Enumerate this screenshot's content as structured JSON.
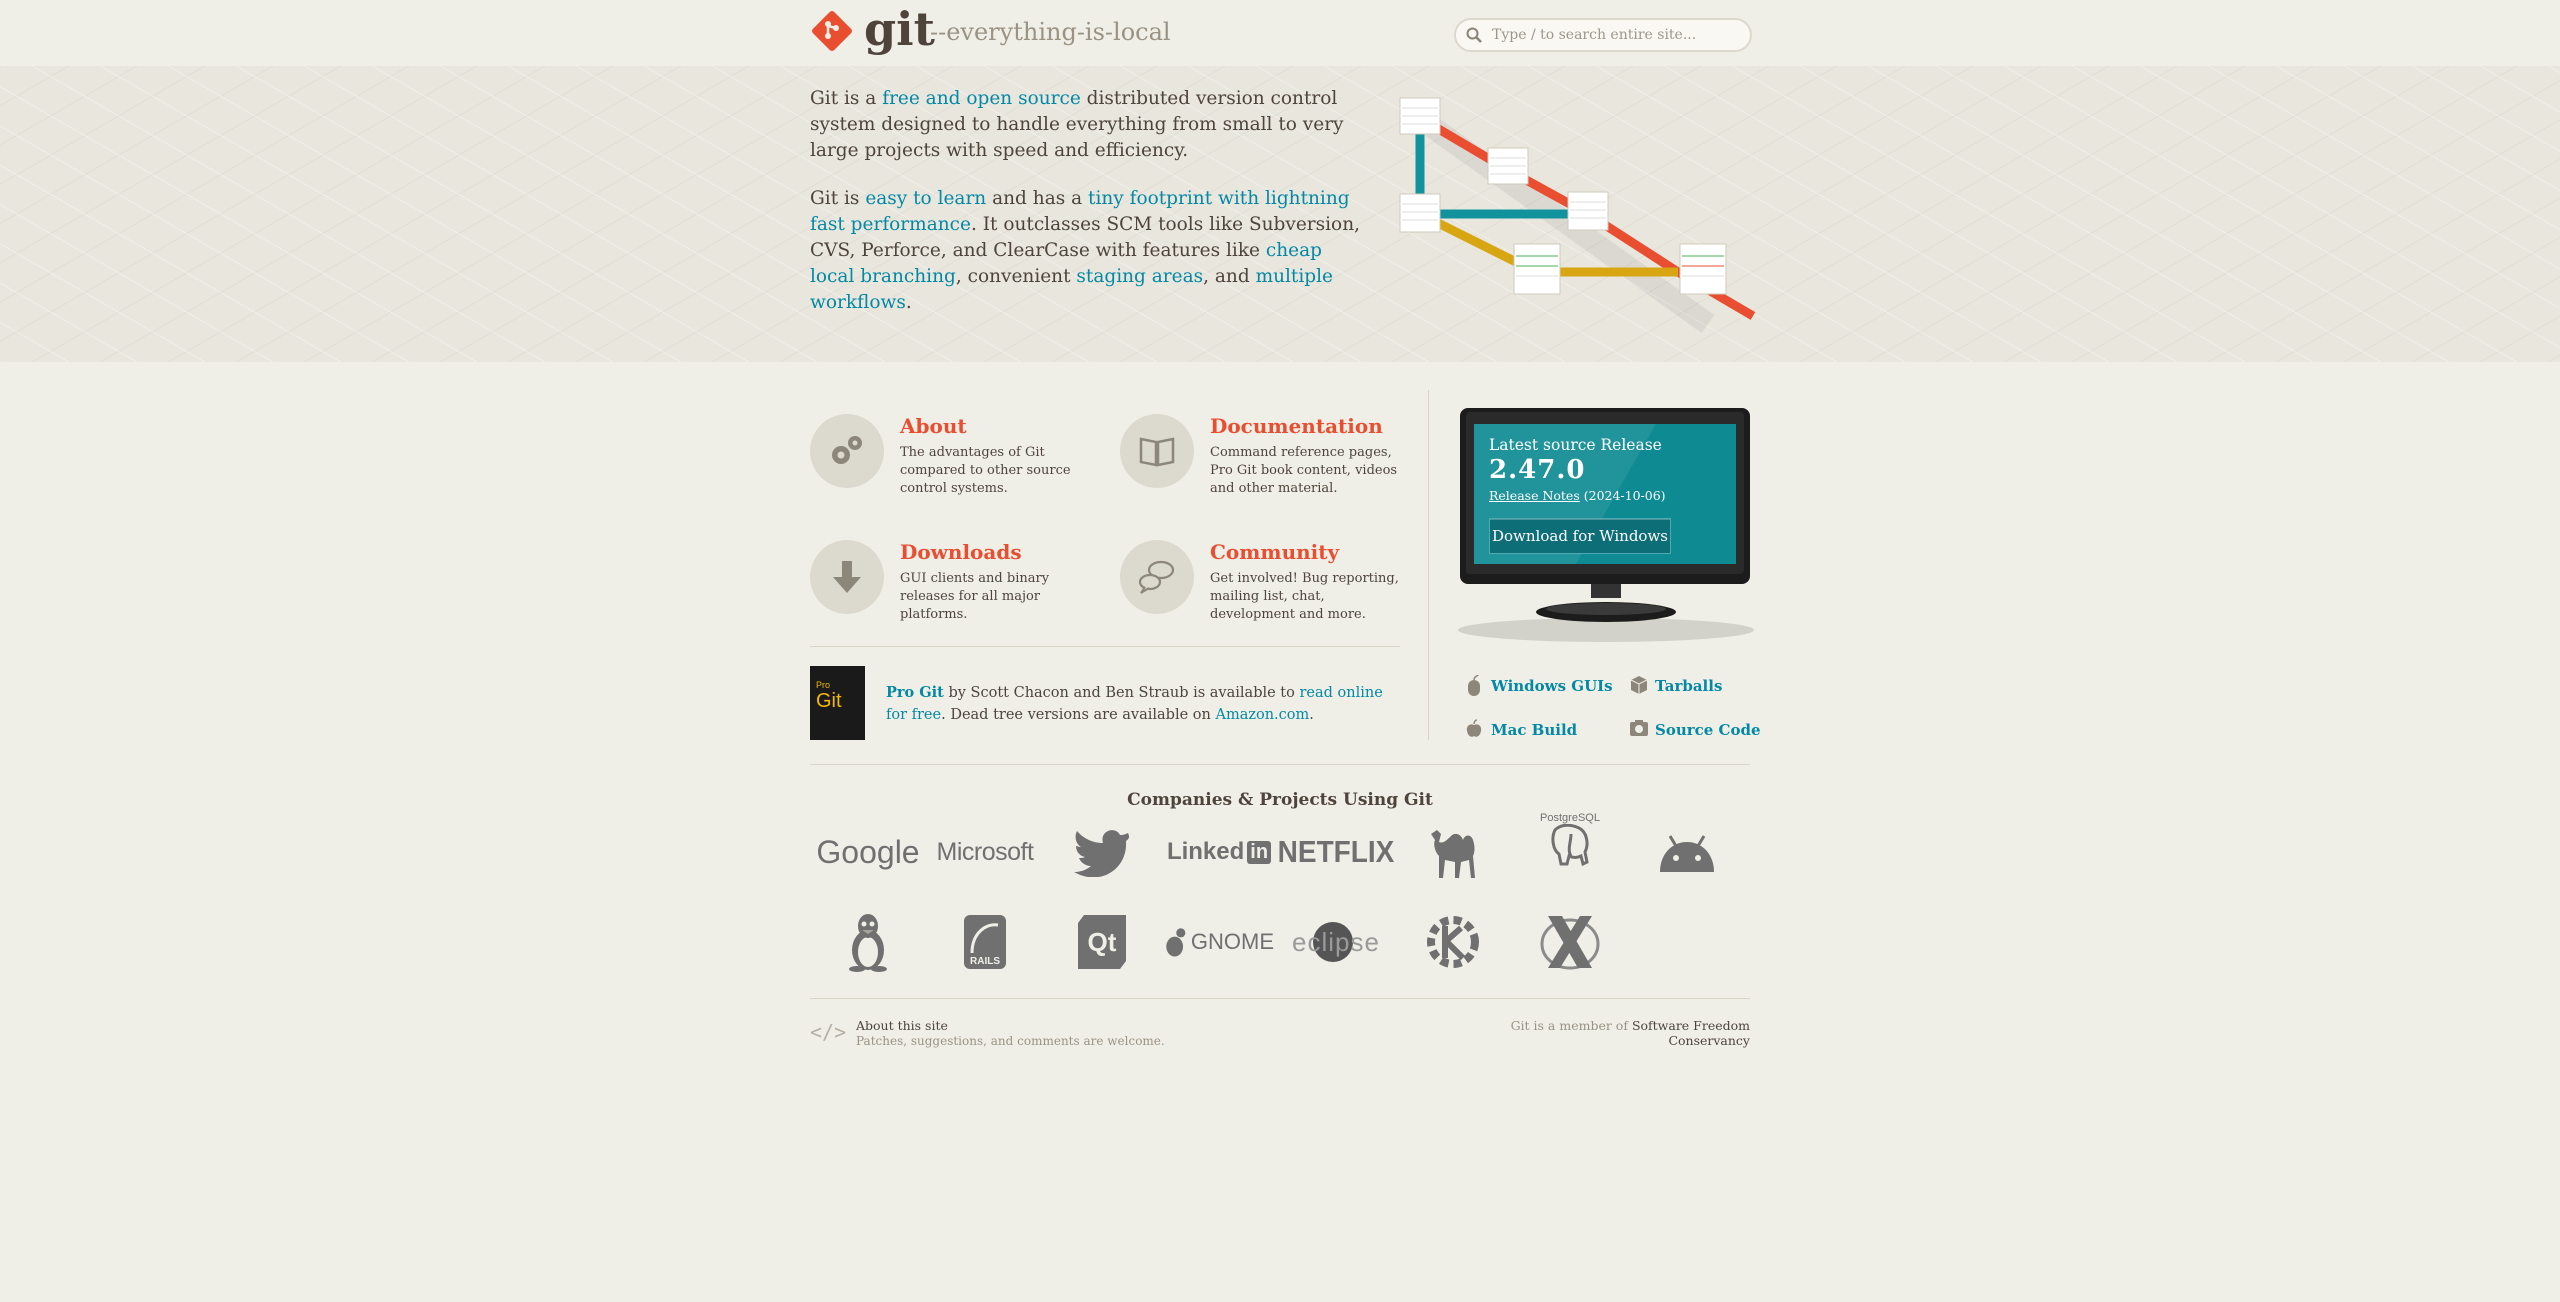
{
  "header": {
    "logo_text": "git",
    "tagline": "--everything-is-local",
    "search_placeholder": "Type / to search entire site..."
  },
  "hero": {
    "p1_a": "Git is a ",
    "p1_link": "free and open source",
    "p1_b": " distributed version control system designed to handle everything from small to very large projects with speed and efficiency.",
    "p2_a": "Git is ",
    "p2_link1": "easy to learn",
    "p2_b": " and has a ",
    "p2_link2": "tiny footprint with lightning fast performance",
    "p2_c": ". It outclasses SCM tools like Subversion, CVS, Perforce, and ClearCase with features like ",
    "p2_link3": "cheap local branching",
    "p2_d": ", convenient ",
    "p2_link4": "staging areas",
    "p2_e": ", and ",
    "p2_link5": "multiple workflows",
    "p2_f": "."
  },
  "features": [
    {
      "title": "About",
      "desc": "The advantages of Git compared to other source control systems.",
      "icon": "gears-icon"
    },
    {
      "title": "Documentation",
      "desc": "Command reference pages, Pro Git book content, videos and other material.",
      "icon": "book-icon"
    },
    {
      "title": "Downloads",
      "desc": "GUI clients and binary releases for all major platforms.",
      "icon": "download-arrow-icon"
    },
    {
      "title": "Community",
      "desc": "Get involved! Bug reporting, mailing list, chat, development and more.",
      "icon": "chat-bubbles-icon"
    }
  ],
  "progit": {
    "title": "Pro Git",
    "text_a": " by Scott Chacon and Ben Straub is available to ",
    "link": "read online for free",
    "text_b": ". Dead tree versions are available on ",
    "amazon": "Amazon.com",
    "text_c": ".",
    "cover_word": "Git",
    "cover_small": "Pro"
  },
  "release": {
    "title": "Latest source Release",
    "version": "2.47.0",
    "notes_label": "Release Notes",
    "date": "(2024-10-06)",
    "download_label": "Download for Windows"
  },
  "download_links": [
    {
      "label": "Windows GUIs",
      "icon": "mouse-icon"
    },
    {
      "label": "Tarballs",
      "icon": "box-icon"
    },
    {
      "label": "Mac Build",
      "icon": "apple-icon"
    },
    {
      "label": "Source Code",
      "icon": "source-code-icon"
    }
  ],
  "companies": {
    "title": "Companies & Projects Using Git",
    "row1": [
      "Google",
      "Microsoft",
      "Twitter",
      "LinkedIn",
      "NETFLIX",
      "Perl",
      "PostgreSQL",
      "Android"
    ],
    "row2": [
      "Linux",
      "RAILS",
      "Qt",
      "GNOME",
      "eclipse",
      "KDE",
      "X.Org"
    ],
    "linkedin_word": "Linked",
    "linkedin_in": "in",
    "postgres_label": "PostgreSQL"
  },
  "footer": {
    "code_glyph": "</>",
    "about_title": "About this site",
    "about_sub": "Patches, suggestions, and comments are welcome.",
    "member_text": "Git is a member of ",
    "member_link": "Software Freedom Conservancy"
  },
  "colors": {
    "accent": "#e94e31",
    "link": "#0388a6",
    "text": "#4e443c",
    "background": "#f0efe7",
    "screen": "#0e8a93"
  }
}
